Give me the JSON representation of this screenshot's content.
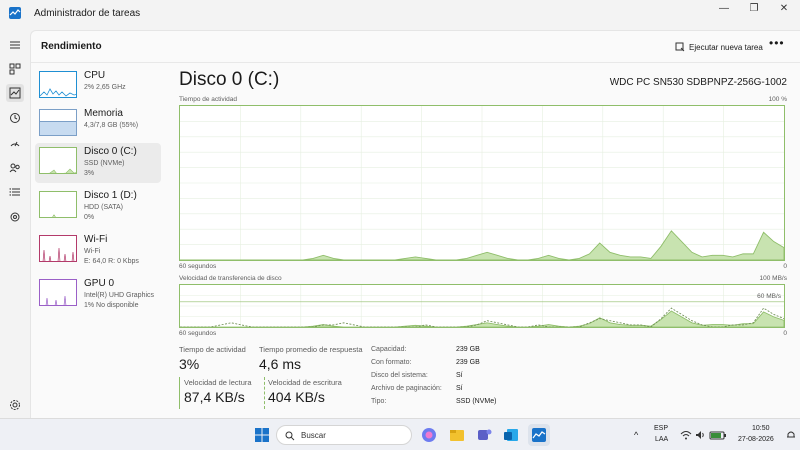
{
  "window": {
    "title": "Administrador de tareas",
    "minimize": "—",
    "maximize": "❐",
    "close": "✕"
  },
  "header": {
    "page_title": "Rendimiento",
    "run_task_label": "Ejecutar nueva tarea",
    "more_label": "•••"
  },
  "nav": {
    "icons": [
      "hamburger-icon",
      "processes-icon",
      "performance-icon",
      "app-history-icon",
      "startup-icon",
      "users-icon",
      "details-icon",
      "services-icon",
      "settings-icon"
    ]
  },
  "sidebar": {
    "items": [
      {
        "name": "CPU",
        "line2": "2% 2,65 GHz",
        "line3": ""
      },
      {
        "name": "Memoria",
        "line2": "4,3/7,8 GB (55%)",
        "line3": ""
      },
      {
        "name": "Disco 0 (C:)",
        "line2": "SSD (NVMe)",
        "line3": "3%"
      },
      {
        "name": "Disco 1 (D:)",
        "line2": "HDD (SATA)",
        "line3": "0%"
      },
      {
        "name": "Wi-Fi",
        "line2": "Wi-Fi",
        "line3": "E: 64,0 R: 0 Kbps"
      },
      {
        "name": "GPU 0",
        "line2": "Intel(R) UHD Graphics",
        "line3": "1% No disponible"
      }
    ]
  },
  "disk": {
    "title": "Disco 0 (C:)",
    "model": "WDC PC SN530 SDBPNPZ-256G-1002",
    "activity_graph": {
      "label": "Tiempo de actividad",
      "max_label": "100 %",
      "time_label": "60 segundos",
      "min_label": "0"
    },
    "transfer_graph": {
      "label": "Velocidad de transferencia de disco",
      "max_label": "100 MB/s",
      "line_label": "60 MB/s",
      "time_label": "60 segundos",
      "min_label": "0"
    }
  },
  "stats": {
    "active_time_label": "Tiempo de actividad",
    "active_time_value": "3%",
    "avg_response_label": "Tiempo promedio de respuesta",
    "avg_response_value": "4,6 ms",
    "read_speed_label": "Velocidad de lectura",
    "read_speed_value": "87,4 KB/s",
    "write_speed_label": "Velocidad de escritura",
    "write_speed_value": "404 KB/s"
  },
  "properties": [
    {
      "label": "Capacidad:",
      "value": "239 GB"
    },
    {
      "label": "Con formato:",
      "value": "239 GB"
    },
    {
      "label": "Disco del sistema:",
      "value": "Sí"
    },
    {
      "label": "Archivo de paginación:",
      "value": "Sí"
    },
    {
      "label": "Tipo:",
      "value": "SSD (NVMe)"
    }
  ],
  "taskbar": {
    "search_label": "Buscar",
    "lang_top": "ESP",
    "lang_bottom": "LAA",
    "time": "10:50",
    "date": "27-08-2026"
  },
  "colors": {
    "disk_accent": "#8fbe6a",
    "disk_fill": "#c8e3b0",
    "cpu_accent": "#1f8fd3",
    "memory_accent": "#7b9fc7",
    "wifi_accent": "#b33a6a",
    "gpu_accent": "#9a5fc7"
  },
  "chart_data": {
    "type": "area",
    "series": [
      {
        "values": [
          0,
          0,
          0,
          0,
          0,
          0,
          0,
          0,
          0,
          0,
          0,
          0,
          0,
          1,
          3,
          1,
          0,
          0,
          0,
          0,
          0,
          0,
          1,
          2,
          1,
          0,
          0,
          0,
          1,
          3,
          5,
          3,
          1,
          0,
          0,
          1,
          3,
          1,
          0,
          1,
          4,
          11,
          5,
          3,
          2,
          2,
          1,
          9,
          19,
          12,
          5,
          2,
          3,
          3,
          2,
          4,
          4,
          18,
          12,
          8
        ]
      },
      {
        "values": [
          0,
          0,
          0,
          0,
          1,
          2,
          1,
          0,
          0,
          0,
          0,
          0,
          0,
          0,
          1,
          1,
          2,
          1,
          0,
          0,
          0,
          0,
          0,
          0,
          1,
          0,
          0,
          0,
          0,
          1,
          3,
          2,
          1,
          0,
          0,
          1,
          0,
          0,
          0,
          0,
          2,
          4,
          3,
          2,
          1,
          1,
          0,
          4,
          9,
          6,
          3,
          1,
          0,
          0,
          1,
          1,
          2,
          9,
          6,
          4
        ]
      }
    ]
  }
}
